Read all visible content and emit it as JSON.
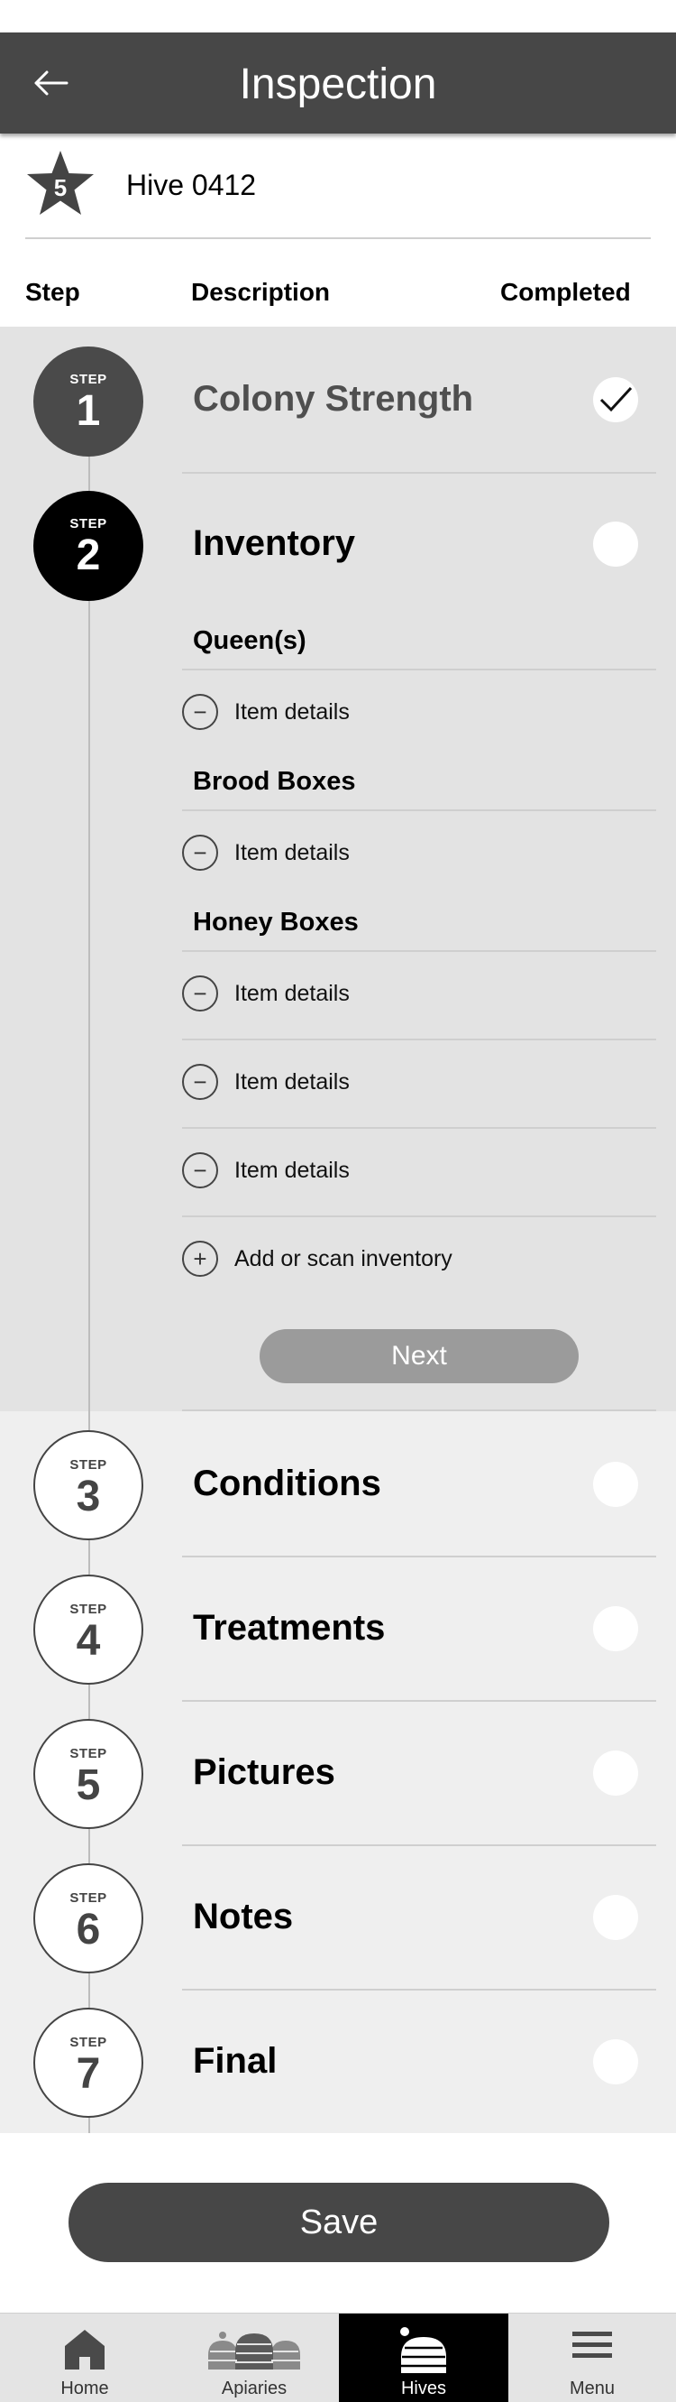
{
  "header": {
    "title": "Inspection"
  },
  "hive": {
    "rating": "5",
    "name": "Hive 0412"
  },
  "columns": {
    "step": "Step",
    "description": "Description",
    "completed": "Completed"
  },
  "step_word": "STEP",
  "steps": [
    {
      "number": "1",
      "title": "Colony Strength",
      "completed": true
    },
    {
      "number": "2",
      "title": "Inventory",
      "completed": false
    },
    {
      "number": "3",
      "title": "Conditions",
      "completed": false
    },
    {
      "number": "4",
      "title": "Treatments",
      "completed": false
    },
    {
      "number": "5",
      "title": "Pictures",
      "completed": false
    },
    {
      "number": "6",
      "title": "Notes",
      "completed": false
    },
    {
      "number": "7",
      "title": "Final",
      "completed": false
    }
  ],
  "inventory": {
    "groups": [
      {
        "label": "Queen(s)",
        "items": [
          "Item details"
        ]
      },
      {
        "label": "Brood Boxes",
        "items": [
          "Item details"
        ]
      },
      {
        "label": "Honey Boxes",
        "items": [
          "Item details",
          "Item details",
          "Item details"
        ]
      }
    ],
    "add_label": "Add or scan inventory",
    "next_label": "Next"
  },
  "save_label": "Save",
  "nav": [
    {
      "label": "Home",
      "icon": "home-icon",
      "active": false
    },
    {
      "label": "Apiaries",
      "icon": "apiaries-icon",
      "active": false
    },
    {
      "label": "Hives",
      "icon": "beehive-icon",
      "active": true
    },
    {
      "label": "Menu",
      "icon": "menu-icon",
      "active": false
    }
  ]
}
